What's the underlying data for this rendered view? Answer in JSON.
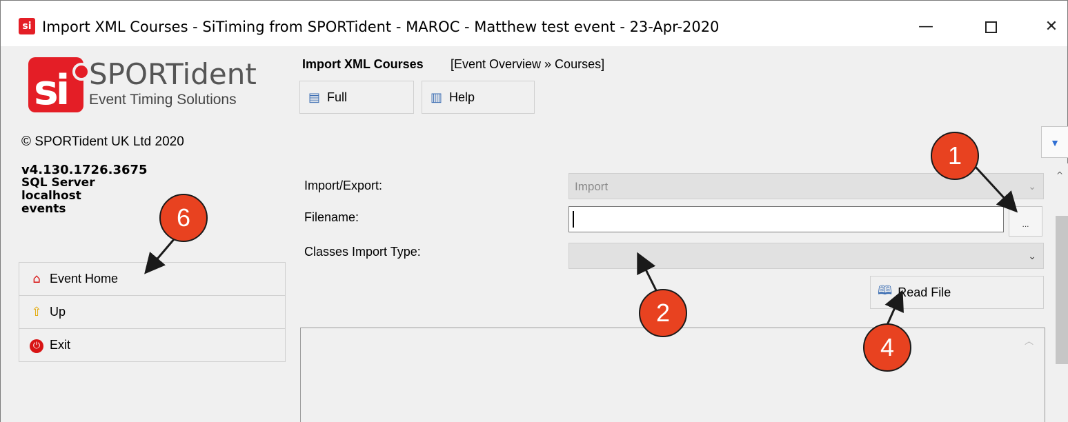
{
  "window": {
    "title": "Import XML Courses - SiTiming from SPORTident - MAROC - Matthew test event - 23-Apr-2020",
    "minimize": "—",
    "close": "✕"
  },
  "branding": {
    "logo_mark": "si",
    "brand_name": "SPORTident",
    "tagline": "Event Timing Solutions",
    "copyright": "© SPORTident UK Ltd 2020"
  },
  "version_info": {
    "version": "v4.130.1726.3675",
    "db_type": "SQL Server",
    "host": "localhost",
    "database": "events"
  },
  "nav": {
    "items": [
      {
        "label": "Event Home",
        "icon": "home-icon"
      },
      {
        "label": "Up",
        "icon": "up-arrow-icon"
      },
      {
        "label": "Exit",
        "icon": "power-icon"
      }
    ]
  },
  "header": {
    "title": "Import XML Courses",
    "breadcrumb": "[Event Overview » Courses]"
  },
  "toolbar": {
    "full_label": "Full",
    "help_label": "Help"
  },
  "form": {
    "import_export_label": "Import/Export:",
    "import_export_value": "Import",
    "filename_label": "Filename:",
    "filename_value": "",
    "browse_label": "...",
    "classes_import_type_label": "Classes Import Type:",
    "classes_import_type_value": "",
    "read_file_label": "Read File"
  },
  "annotations": {
    "c1": "1",
    "c2": "2",
    "c4": "4",
    "c6": "6"
  },
  "colors": {
    "callout_fill": "#e84220",
    "brand_red": "#e41e26",
    "accent_blue": "#2f6fd3"
  }
}
